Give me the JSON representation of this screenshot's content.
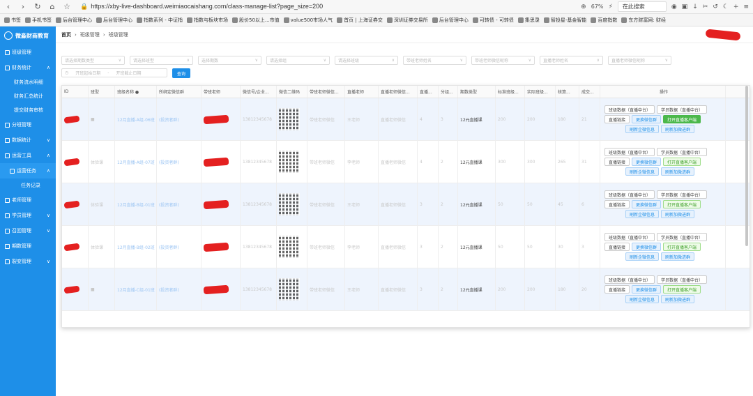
{
  "browser": {
    "url": "https://xby-live-dashboard.weimiaocaishang.com/class-manage-list?page_size=200",
    "zoom": "67%",
    "search_placeholder": "在此搜索",
    "bookmarks": [
      "书签",
      "手机书签",
      "后台管理中心",
      "后台管理中心",
      "指数系列 - 中证指",
      "指数与板块市场",
      "股价50以上...市值",
      "value500市场人气",
      "首页 | 上海证券交",
      "深圳证券交易所",
      "后台管理中心",
      "可转债 - 可转债",
      "集思录",
      "智投星-基金智能",
      "百度指数",
      "东方财富网: 财经"
    ]
  },
  "sidebar": {
    "logo": "微淼财商教育",
    "items": [
      {
        "label": "班级管理",
        "arrow": ""
      },
      {
        "label": "财务统计",
        "arrow": "∧"
      },
      {
        "label": "财务流水明细",
        "sub": true
      },
      {
        "label": "财务汇总统计",
        "sub": true
      },
      {
        "label": "提交财务审核",
        "sub": true
      },
      {
        "label": "分班管理",
        "arrow": ""
      },
      {
        "label": "数据统计",
        "arrow": "∨"
      },
      {
        "label": "运营工具",
        "arrow": "∧"
      },
      {
        "label": "运营任务",
        "arrow": "∧",
        "sub": true
      },
      {
        "label": "任务记录",
        "deeper": true
      },
      {
        "label": "老师管理",
        "arrow": ""
      },
      {
        "label": "学员管理",
        "arrow": "∨"
      },
      {
        "label": "召回管理",
        "arrow": "∨"
      },
      {
        "label": "期数管理",
        "arrow": ""
      },
      {
        "label": "裂变管理",
        "arrow": "∨"
      }
    ]
  },
  "breadcrumb": [
    "首页",
    "班级管理",
    "班级管理"
  ],
  "filters": {
    "row1": [
      "请选择期数类型",
      "请选择班型",
      "选择期数",
      "请选择组",
      "请选择班级",
      "带班老师姓名",
      "带班老师微信昵称",
      "直播老师姓名",
      "直播老师微信昵称"
    ],
    "date_start": "开班起始日期",
    "date_sep": "-",
    "date_end": "开班截止日期",
    "query_label": "查询"
  },
  "table": {
    "headers": [
      "ID",
      "班型",
      "班级名称 ●",
      "所绑定微信群",
      "带班老师",
      "微信号/企业...",
      "微信二维码",
      "带班老师微信...",
      "直播老师",
      "直播老师微信...",
      "直播...",
      "分组...",
      "期数类型",
      "标准班级...",
      "实际班级...",
      "核算...",
      "成交...",
      "操作"
    ],
    "rows": [
      {
        "type": "■",
        "name": "12月直播-A组-06班",
        "group": "(投资者群)",
        "wx": "13812345678",
        "bwx": "带班老师微信",
        "live": "王老师",
        "lwx": "直播老师微信",
        "lv": "4",
        "grp": "3",
        "period": "12元直播课",
        "std": "200",
        "act": "200",
        "calc": "180",
        "deal": "21"
      },
      {
        "type": "体验课",
        "name": "12月直播-A组-07班",
        "group": "(投资者群)",
        "wx": "13812345678",
        "bwx": "带班老师微信",
        "live": "李老师",
        "lwx": "直播老师微信",
        "lv": "4",
        "grp": "2",
        "period": "12元直播课",
        "std": "300",
        "act": "300",
        "calc": "265",
        "deal": "31"
      },
      {
        "type": "体验课",
        "name": "12月直播-B组-01班",
        "group": "(投资者群)",
        "wx": "13812345678",
        "bwx": "带班老师微信",
        "live": "王老师",
        "lwx": "直播老师微信",
        "lv": "3",
        "grp": "2",
        "period": "12元直播课",
        "std": "50",
        "act": "50",
        "calc": "45",
        "deal": "6"
      },
      {
        "type": "体验课",
        "name": "12月直播-B组-02班",
        "group": "(投资者群)",
        "wx": "13812345678",
        "bwx": "带班老师微信",
        "live": "李老师",
        "lwx": "直播老师微信",
        "lv": "3",
        "grp": "2",
        "period": "12元直播课",
        "std": "50",
        "act": "50",
        "calc": "30",
        "deal": "3"
      },
      {
        "type": "■",
        "name": "12月直播-C组-01班",
        "group": "(投资者群)",
        "wx": "13812345678",
        "bwx": "带班老师微信",
        "live": "王老师",
        "lwx": "直播老师微信",
        "lv": "3",
        "grp": "2",
        "period": "12元直播课",
        "std": "200",
        "act": "200",
        "calc": "180",
        "deal": "20"
      }
    ],
    "ops": {
      "class_data": "班级数据（直播中台）",
      "student_data": "学员数据（直播中台）",
      "live_link": "直播链接",
      "change_wechat": "更换微信群",
      "open_client": "打开直播客户端",
      "refresh_wecom": "刷新企微信息",
      "refresh_join": "刷新加微进群"
    }
  }
}
